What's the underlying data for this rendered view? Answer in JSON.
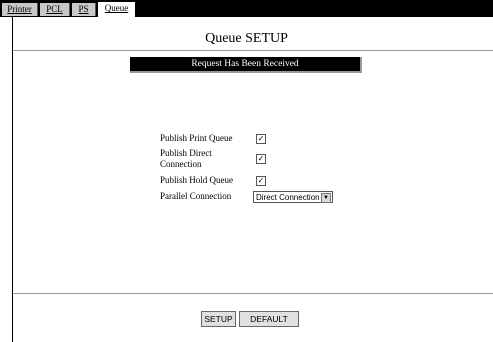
{
  "tabs": [
    {
      "label": "Printer",
      "active": false
    },
    {
      "label": "PCL",
      "active": false
    },
    {
      "label": "PS",
      "active": false
    },
    {
      "label": "Queue",
      "active": true
    }
  ],
  "title": "Queue SETUP",
  "status_message": "Request Has Been Received",
  "settings": {
    "publish_print_queue": {
      "label": "Publish Print Queue",
      "checked": true
    },
    "publish_direct_connection": {
      "label_line1": "Publish Direct",
      "label_line2": "Connection",
      "checked": true
    },
    "publish_hold_queue": {
      "label": "Publish Hold Queue",
      "checked": true
    },
    "parallel_connection": {
      "label": "Parallel Connection",
      "selected": "Direct Connection"
    }
  },
  "buttons": {
    "setup": "SETUP",
    "default": "DEFAULT"
  },
  "check_glyph": "☑"
}
